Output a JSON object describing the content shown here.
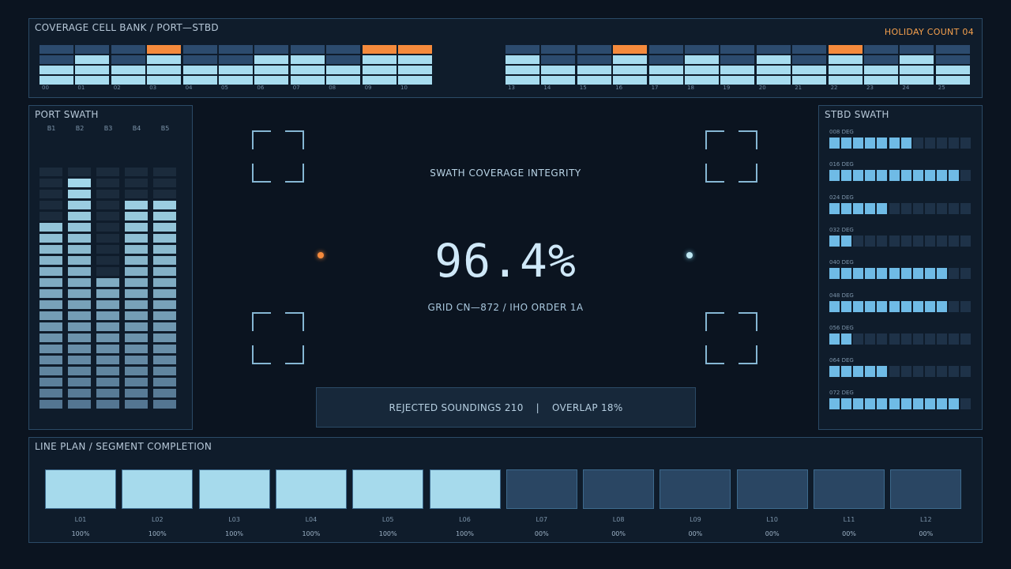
{
  "bank": {
    "title": "COVERAGE CELL BANK / PORT—STBD",
    "holiday_count": "HOLIDAY COUNT 04",
    "cells": [
      {
        "label": "00",
        "rows": [
          "d",
          "d",
          "l",
          "l"
        ]
      },
      {
        "label": "01",
        "rows": [
          "d",
          "l",
          "l",
          "l"
        ]
      },
      {
        "label": "02",
        "rows": [
          "d",
          "d",
          "l",
          "l"
        ]
      },
      {
        "label": "03",
        "rows": [
          "o",
          "l",
          "l",
          "l"
        ]
      },
      {
        "label": "04",
        "rows": [
          "d",
          "d",
          "l",
          "l"
        ]
      },
      {
        "label": "05",
        "rows": [
          "d",
          "d",
          "l",
          "l"
        ]
      },
      {
        "label": "06",
        "rows": [
          "d",
          "l",
          "l",
          "l"
        ]
      },
      {
        "label": "07",
        "rows": [
          "d",
          "l",
          "l",
          "l"
        ]
      },
      {
        "label": "08",
        "rows": [
          "d",
          "d",
          "l",
          "l"
        ]
      },
      {
        "label": "09",
        "rows": [
          "o",
          "l",
          "l",
          "l"
        ]
      },
      {
        "label": "10",
        "rows": [
          "o",
          "l",
          "l",
          "l"
        ]
      },
      {
        "label": "13",
        "rows": [
          "d",
          "l",
          "l",
          "l"
        ]
      },
      {
        "label": "14",
        "rows": [
          "d",
          "d",
          "l",
          "l"
        ]
      },
      {
        "label": "15",
        "rows": [
          "d",
          "d",
          "l",
          "l"
        ]
      },
      {
        "label": "16",
        "rows": [
          "o",
          "l",
          "l",
          "l"
        ]
      },
      {
        "label": "17",
        "rows": [
          "d",
          "d",
          "l",
          "l"
        ]
      },
      {
        "label": "18",
        "rows": [
          "d",
          "l",
          "l",
          "l"
        ]
      },
      {
        "label": "19",
        "rows": [
          "d",
          "d",
          "l",
          "l"
        ]
      },
      {
        "label": "20",
        "rows": [
          "d",
          "l",
          "l",
          "l"
        ]
      },
      {
        "label": "21",
        "rows": [
          "d",
          "d",
          "l",
          "l"
        ]
      },
      {
        "label": "22",
        "rows": [
          "o",
          "l",
          "l",
          "l"
        ]
      },
      {
        "label": "23",
        "rows": [
          "d",
          "d",
          "l",
          "l"
        ]
      },
      {
        "label": "24",
        "rows": [
          "d",
          "l",
          "l",
          "l"
        ]
      },
      {
        "label": "25",
        "rows": [
          "d",
          "d",
          "l",
          "l"
        ]
      }
    ]
  },
  "port": {
    "title": "PORT SWATH",
    "beams": [
      {
        "label": "B1",
        "level": 17
      },
      {
        "label": "B2",
        "level": 21
      },
      {
        "label": "B3",
        "level": 12
      },
      {
        "label": "B4",
        "level": 19
      },
      {
        "label": "B5",
        "level": 19
      }
    ],
    "total_segments": 22
  },
  "stbd": {
    "title": "STBD SWATH",
    "total_segments": 12,
    "rows": [
      {
        "label": "008 DEG",
        "filled": 7
      },
      {
        "label": "016 DEG",
        "filled": 11
      },
      {
        "label": "024 DEG",
        "filled": 5
      },
      {
        "label": "032 DEG",
        "filled": 2
      },
      {
        "label": "040 DEG",
        "filled": 10
      },
      {
        "label": "048 DEG",
        "filled": 10
      },
      {
        "label": "056 DEG",
        "filled": 2
      },
      {
        "label": "064 DEG",
        "filled": 5
      },
      {
        "label": "072 DEG",
        "filled": 11
      }
    ]
  },
  "center": {
    "title": "SWATH COVERAGE INTEGRITY",
    "value": "96.4%",
    "grid": "GRID CN—872 / IHO ORDER 1A",
    "rejected": "REJECTED SOUNDINGS 210",
    "separator": "|",
    "overlap": "OVERLAP 18%"
  },
  "lines": {
    "title": "LINE PLAN / SEGMENT COMPLETION",
    "items": [
      {
        "name": "L01",
        "pct": "100%",
        "complete": true
      },
      {
        "name": "L02",
        "pct": "100%",
        "complete": true
      },
      {
        "name": "L03",
        "pct": "100%",
        "complete": true
      },
      {
        "name": "L04",
        "pct": "100%",
        "complete": true
      },
      {
        "name": "L05",
        "pct": "100%",
        "complete": true
      },
      {
        "name": "L06",
        "pct": "100%",
        "complete": true
      },
      {
        "name": "L07",
        "pct": "00%",
        "complete": false
      },
      {
        "name": "L08",
        "pct": "00%",
        "complete": false
      },
      {
        "name": "L09",
        "pct": "00%",
        "complete": false
      },
      {
        "name": "L10",
        "pct": "00%",
        "complete": false
      },
      {
        "name": "L11",
        "pct": "00%",
        "complete": false
      },
      {
        "name": "L12",
        "pct": "00%",
        "complete": false
      }
    ]
  },
  "colors": {
    "accent": "#a6daec",
    "warning": "#f58a3c",
    "panel_border": "#2b4a66",
    "dim_cell": "#2c4b6e"
  }
}
